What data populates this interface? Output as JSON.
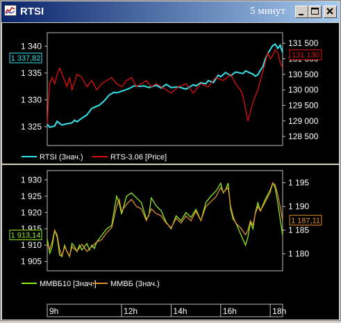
{
  "window": {
    "title": "RTSI",
    "period": "5 минут",
    "buttons": [
      "minimize",
      "maximize",
      "close"
    ]
  },
  "colors": {
    "rtsi": "#33e5ee",
    "rts_futures": "#e01010",
    "mmvb10": "#90ee20",
    "mmvb": "#e09030",
    "axis": "#c0c0c0"
  },
  "chart_data": [
    {
      "type": "line",
      "title": "",
      "legend_position": "bottom",
      "left_axis": {
        "ticks": [
          "1 340",
          "1 335",
          "1 330",
          "1 325"
        ],
        "ylim": [
          1322,
          1342
        ],
        "current_value": "1 337,82"
      },
      "right_axis": {
        "ticks": [
          "131 500",
          "131 000",
          "130 500",
          "130 000",
          "129 500",
          "129 000",
          "128 500"
        ],
        "ylim": [
          128300,
          131750
        ],
        "current_value": "131 130"
      },
      "series": [
        {
          "name": "RTSI (Знач.)",
          "axis": "left",
          "x": [
            9.0,
            9.1,
            9.3,
            9.4,
            9.5,
            9.6,
            9.75,
            10.0,
            10.1,
            10.2,
            10.4,
            10.6,
            10.8,
            11.1,
            11.3,
            11.5,
            11.7,
            11.8,
            12.0,
            12.3,
            12.5,
            12.7,
            12.9,
            13.1,
            13.4,
            13.6,
            13.8,
            14.0,
            14.3,
            14.6,
            14.9,
            15.0,
            15.2,
            15.4,
            15.5,
            15.7,
            15.9,
            16.0,
            16.2,
            16.4,
            16.6,
            16.9,
            17.0,
            17.2,
            17.3,
            17.4,
            17.5,
            17.6,
            17.7,
            17.8,
            17.9,
            18.0,
            18.1,
            18.2,
            18.3,
            18.4,
            18.5
          ],
          "values": [
            1325.5,
            1324.9,
            1325.1,
            1326.0,
            1325.6,
            1325.3,
            1325.5,
            1325.7,
            1326.2,
            1325.9,
            1326.6,
            1327.2,
            1328.4,
            1329.0,
            1329.8,
            1330.9,
            1331.4,
            1331.3,
            1331.6,
            1332.1,
            1332.6,
            1332.5,
            1332.6,
            1332.3,
            1332.7,
            1332.2,
            1332.9,
            1332.3,
            1332.4,
            1332.0,
            1332.8,
            1332.6,
            1333.2,
            1333.0,
            1333.6,
            1333.2,
            1334.6,
            1334.3,
            1335.1,
            1334.5,
            1335.2,
            1334.9,
            1335.4,
            1335.0,
            1334.8,
            1334.4,
            1334.7,
            1335.5,
            1336.2,
            1337.6,
            1338.6,
            1339.4,
            1340.1,
            1340.4,
            1339.6,
            1340.2,
            1338.8
          ]
        },
        {
          "name": "RTS-3.06 [Price]",
          "axis": "right",
          "x": [
            9.0,
            9.05,
            9.1,
            9.2,
            9.3,
            9.4,
            9.5,
            9.6,
            9.7,
            9.8,
            9.9,
            10.0,
            10.2,
            10.4,
            10.6,
            10.8,
            11.0,
            11.2,
            11.4,
            11.6,
            11.8,
            12.0,
            12.2,
            12.4,
            12.6,
            12.8,
            13.0,
            13.2,
            13.4,
            13.6,
            13.8,
            14.0,
            14.3,
            14.6,
            14.9,
            15.2,
            15.5,
            15.8,
            16.1,
            16.4,
            16.6,
            16.8,
            16.9,
            17.0,
            17.1,
            17.2,
            17.3,
            17.4,
            17.5,
            17.6,
            17.7,
            17.8,
            17.9,
            18.0,
            18.1,
            18.2,
            18.3,
            18.4,
            18.5
          ],
          "values": [
            128900,
            129700,
            130200,
            130400,
            130200,
            130500,
            130700,
            130500,
            130300,
            130100,
            130400,
            130000,
            130500,
            130400,
            130100,
            130300,
            130000,
            130200,
            130300,
            130400,
            130200,
            130100,
            130300,
            130400,
            130100,
            130200,
            130300,
            130100,
            130200,
            130100,
            130000,
            129900,
            130100,
            130200,
            129900,
            130200,
            130100,
            130400,
            130300,
            130500,
            130200,
            130000,
            129800,
            129400,
            129000,
            129300,
            129600,
            129800,
            130000,
            130300,
            130600,
            130900,
            131200,
            131000,
            131100,
            131300,
            131200,
            130900,
            130700
          ]
        }
      ]
    },
    {
      "type": "line",
      "title": "",
      "legend_position": "bottom",
      "left_axis": {
        "ticks": [
          "1 930",
          "1 925",
          "1 920",
          "1 915",
          "1 910",
          "1 905"
        ],
        "ylim": [
          1903,
          1932
        ],
        "current_value": "1 913,14"
      },
      "right_axis": {
        "ticks": [
          "1 195",
          "1 190",
          "1 185",
          "1 180"
        ],
        "ylim": [
          1177,
          1197
        ],
        "current_value": "1 187,11"
      },
      "x_axis": {
        "ticks": [
          "9h",
          "12h",
          "14h",
          "16h",
          "18h"
        ],
        "tick_values": [
          9,
          12,
          14,
          16,
          18
        ]
      },
      "series": [
        {
          "name": "ММВБ10 [Знач.]",
          "axis": "left",
          "x": [
            9.0,
            9.1,
            9.2,
            9.3,
            9.4,
            9.5,
            9.6,
            9.7,
            9.8,
            9.9,
            10.0,
            10.1,
            10.2,
            10.3,
            10.4,
            10.5,
            10.6,
            10.7,
            10.8,
            10.9,
            11.0,
            11.2,
            11.4,
            11.6,
            11.8,
            11.9,
            12.0,
            12.2,
            12.4,
            12.6,
            12.8,
            13.0,
            13.1,
            13.2,
            13.4,
            13.6,
            13.8,
            14.0,
            14.2,
            14.4,
            14.6,
            14.8,
            15.0,
            15.2,
            15.4,
            15.6,
            15.8,
            16.0,
            16.1,
            16.2,
            16.3,
            16.4,
            16.5,
            16.6,
            16.8,
            17.0,
            17.1,
            17.2,
            17.3,
            17.4,
            17.5,
            17.6,
            17.8,
            18.0,
            18.1,
            18.2,
            18.3,
            18.4,
            18.5
          ],
          "values": [
            1912.0,
            1907.5,
            1909.5,
            1914.5,
            1912.5,
            1907.0,
            1906.5,
            1910.0,
            1908.0,
            1906.5,
            1910.5,
            1909.5,
            1908.0,
            1910.0,
            1908.5,
            1909.5,
            1910.5,
            1908.5,
            1910.0,
            1909.0,
            1911.0,
            1913.0,
            1915.0,
            1916.0,
            1925.0,
            1923.0,
            1919.5,
            1925.0,
            1926.0,
            1924.5,
            1923.0,
            1918.0,
            1919.0,
            1924.5,
            1922.0,
            1920.5,
            1917.0,
            1915.0,
            1919.0,
            1917.5,
            1920.0,
            1918.5,
            1921.0,
            1917.5,
            1923.0,
            1925.0,
            1926.5,
            1929.0,
            1926.0,
            1927.0,
            1929.0,
            1921.0,
            1918.0,
            1917.0,
            1913.5,
            1910.0,
            1912.5,
            1917.0,
            1915.0,
            1920.0,
            1923.0,
            1920.5,
            1924.0,
            1927.0,
            1929.0,
            1927.5,
            1923.0,
            1918.0,
            1913.0
          ]
        },
        {
          "name": "ММВБ (Знач.)",
          "axis": "right",
          "x": [
            9.0,
            9.1,
            9.2,
            9.3,
            9.4,
            9.5,
            9.6,
            9.7,
            9.8,
            9.9,
            10.0,
            10.2,
            10.4,
            10.6,
            10.8,
            11.0,
            11.2,
            11.4,
            11.6,
            11.8,
            11.9,
            12.0,
            12.2,
            12.4,
            12.6,
            12.8,
            13.0,
            13.2,
            13.4,
            13.6,
            13.8,
            14.0,
            14.2,
            14.4,
            14.6,
            14.8,
            15.0,
            15.2,
            15.4,
            15.6,
            15.8,
            16.0,
            16.1,
            16.2,
            16.3,
            16.4,
            16.5,
            16.6,
            16.8,
            17.0,
            17.1,
            17.2,
            17.3,
            17.4,
            17.5,
            17.6,
            17.8,
            18.0,
            18.1,
            18.2,
            18.3,
            18.4,
            18.5
          ],
          "values": [
            1182.0,
            1181.0,
            1182.5,
            1185.0,
            1184.0,
            1181.0,
            1179.5,
            1181.5,
            1180.5,
            1179.5,
            1181.5,
            1180.5,
            1182.0,
            1180.5,
            1181.5,
            1182.5,
            1183.0,
            1184.5,
            1185.5,
            1190.0,
            1191.5,
            1189.0,
            1190.5,
            1191.5,
            1190.0,
            1189.5,
            1187.0,
            1189.5,
            1188.5,
            1188.0,
            1186.5,
            1185.5,
            1187.5,
            1186.5,
            1188.0,
            1187.0,
            1189.0,
            1187.0,
            1190.0,
            1191.0,
            1192.0,
            1194.0,
            1193.0,
            1193.5,
            1194.0,
            1190.0,
            1188.0,
            1186.5,
            1185.5,
            1184.0,
            1185.0,
            1187.0,
            1186.0,
            1188.5,
            1190.0,
            1189.0,
            1191.0,
            1193.0,
            1195.0,
            1194.5,
            1192.5,
            1190.0,
            1187.0
          ]
        }
      ]
    }
  ]
}
